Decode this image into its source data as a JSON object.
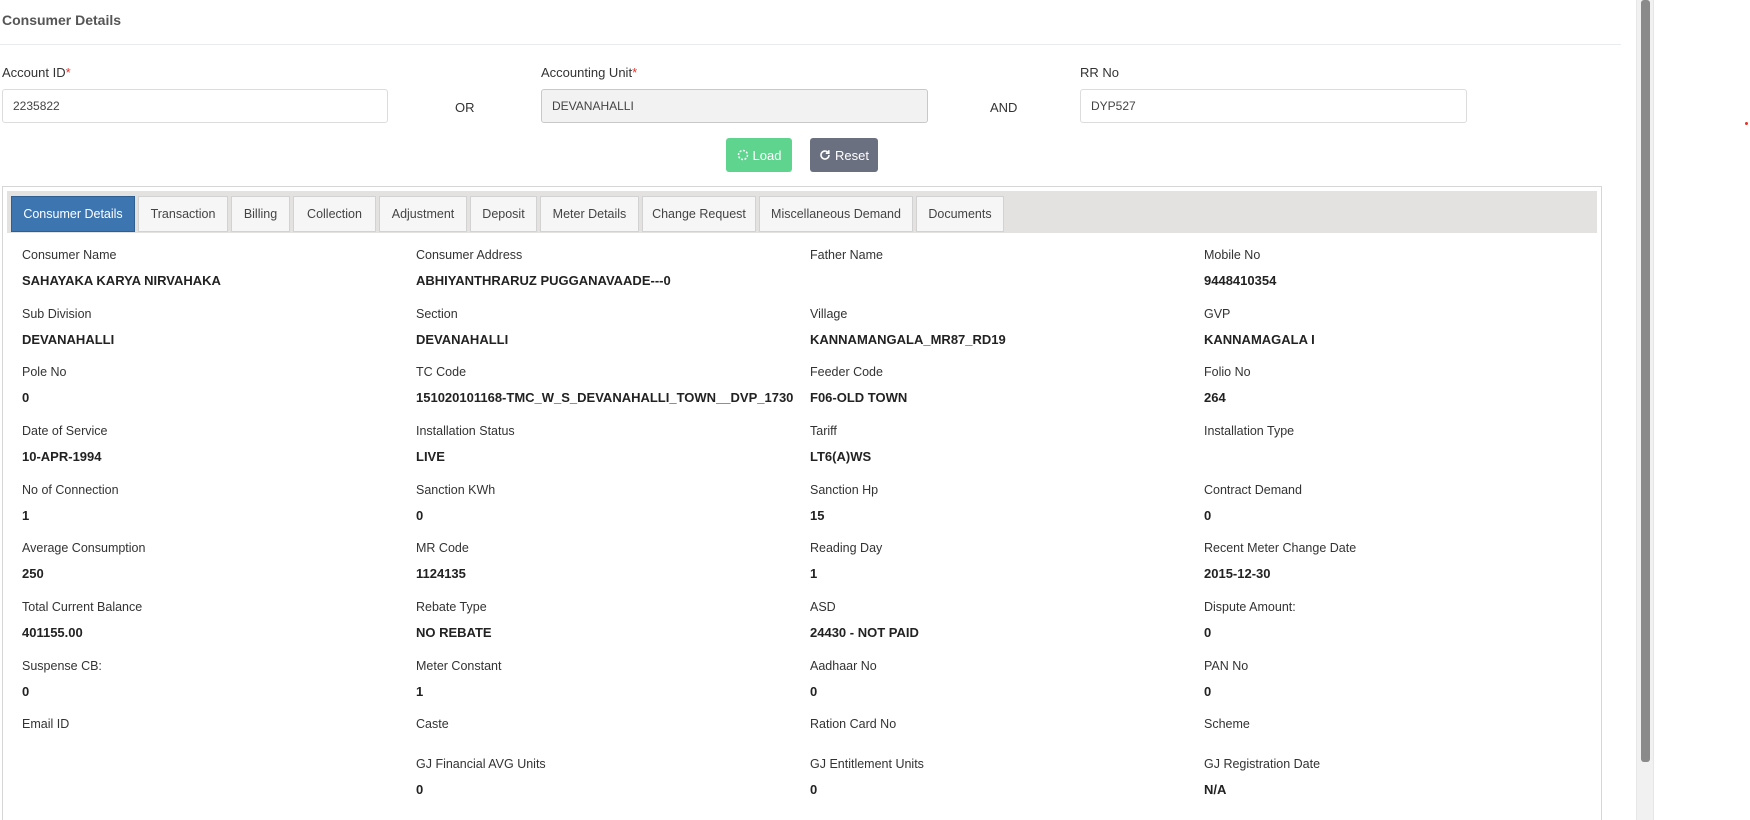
{
  "header": {
    "title": "Consumer Details"
  },
  "search": {
    "account_id_label": "Account ID",
    "account_id_value": "2235822",
    "or_label": "OR",
    "accounting_unit_label": "Accounting Unit",
    "accounting_unit_value": "DEVANAHALLI",
    "and_label": "AND",
    "rr_no_label": "RR No",
    "rr_no_value": "DYP527",
    "required_mark": "*"
  },
  "buttons": {
    "load": "Load",
    "reset": "Reset"
  },
  "tabs": [
    {
      "label": "Consumer Details",
      "active": true
    },
    {
      "label": "Transaction"
    },
    {
      "label": "Billing"
    },
    {
      "label": "Collection"
    },
    {
      "label": "Adjustment"
    },
    {
      "label": "Deposit"
    },
    {
      "label": "Meter Details"
    },
    {
      "label": "Change Request"
    },
    {
      "label": "Miscellaneous Demand"
    },
    {
      "label": "Documents"
    }
  ],
  "details": [
    [
      {
        "label": "Consumer Name",
        "value": "SAHAYAKA KARYA NIRVAHAKA"
      },
      {
        "label": "Consumer Address",
        "value": "ABHIYANTHRARUZ PUGGANAVAADE---0"
      },
      {
        "label": "Father Name",
        "value": ""
      },
      {
        "label": "Mobile No",
        "value": "9448410354"
      }
    ],
    [
      {
        "label": "Sub Division",
        "value": "DEVANAHALLI"
      },
      {
        "label": "Section",
        "value": "DEVANAHALLI"
      },
      {
        "label": "Village",
        "value": "KANNAMANGALA_MR87_RD19"
      },
      {
        "label": "GVP",
        "value": "KANNAMAGALA I"
      }
    ],
    [
      {
        "label": "Pole No",
        "value": "0"
      },
      {
        "label": "TC Code",
        "value": "151020101168-TMC_W_S_DEVANAHALLI_TOWN__DVP_1730"
      },
      {
        "label": "Feeder Code",
        "value": "F06-OLD TOWN"
      },
      {
        "label": "Folio No",
        "value": "264"
      }
    ],
    [
      {
        "label": "Date of Service",
        "value": "10-APR-1994"
      },
      {
        "label": "Installation Status",
        "value": "LIVE"
      },
      {
        "label": "Tariff",
        "value": "LT6(A)WS"
      },
      {
        "label": "Installation Type",
        "value": ""
      }
    ],
    [
      {
        "label": "No of Connection",
        "value": "1"
      },
      {
        "label": "Sanction KWh",
        "value": "0"
      },
      {
        "label": "Sanction Hp",
        "value": "15"
      },
      {
        "label": "Contract Demand",
        "value": "0"
      }
    ],
    [
      {
        "label": "Average Consumption",
        "value": "250"
      },
      {
        "label": "MR Code",
        "value": "1124135"
      },
      {
        "label": "Reading Day",
        "value": "1"
      },
      {
        "label": "Recent Meter Change Date",
        "value": "2015-12-30"
      }
    ],
    [
      {
        "label": "Total Current Balance",
        "value": "401155.00"
      },
      {
        "label": "Rebate Type",
        "value": "NO REBATE"
      },
      {
        "label": "ASD",
        "value": "24430 - NOT PAID"
      },
      {
        "label": "Dispute Amount:",
        "value": "0"
      }
    ],
    [
      {
        "label": "Suspense CB:",
        "value": "0"
      },
      {
        "label": "Meter Constant",
        "value": "1"
      },
      {
        "label": "Aadhaar No",
        "value": "0"
      },
      {
        "label": "PAN No",
        "value": "0"
      }
    ],
    [
      {
        "label": "Email ID",
        "value": ""
      },
      {
        "label": "Caste",
        "value": ""
      },
      {
        "label": "Ration Card No",
        "value": ""
      },
      {
        "label": "Scheme",
        "value": ""
      }
    ],
    [
      {
        "label": "",
        "value": ""
      },
      {
        "label": "GJ Financial AVG Units",
        "value": "0"
      },
      {
        "label": "GJ Entitlement Units",
        "value": "0"
      },
      {
        "label": "GJ Registration Date",
        "value": "N/A"
      }
    ]
  ]
}
